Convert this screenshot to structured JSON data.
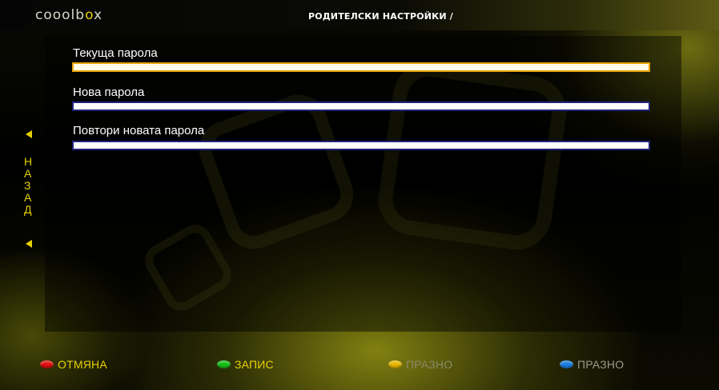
{
  "header": {
    "logo_text_1": "coool",
    "logo_text_2": "b",
    "logo_text_3": "o",
    "logo_text_4": "x",
    "title": "РОДИТЕЛСКИ НАСТРОЙКИ /"
  },
  "form": {
    "current_password_label": "Текуща парола",
    "current_password_value": "",
    "new_password_label": "Нова парола",
    "new_password_value": "",
    "repeat_password_label": "Повтори новата парола",
    "repeat_password_value": ""
  },
  "back_nav": {
    "letters": [
      "Н",
      "А",
      "З",
      "А",
      "Д"
    ]
  },
  "footer": {
    "red_label": "ОТМЯНА",
    "green_label": "ЗАПИС",
    "yellow_label": "ПРАЗНО",
    "blue_label": "ПРАЗНО"
  },
  "colors": {
    "accent_yellow": "#e6d200",
    "red_button": "#e01010",
    "green_button": "#18c018",
    "yellow_button": "#e8b800",
    "blue_button": "#1a7ee0",
    "disabled_label": "#7a7a6a",
    "focus_border": "#e8a400"
  }
}
